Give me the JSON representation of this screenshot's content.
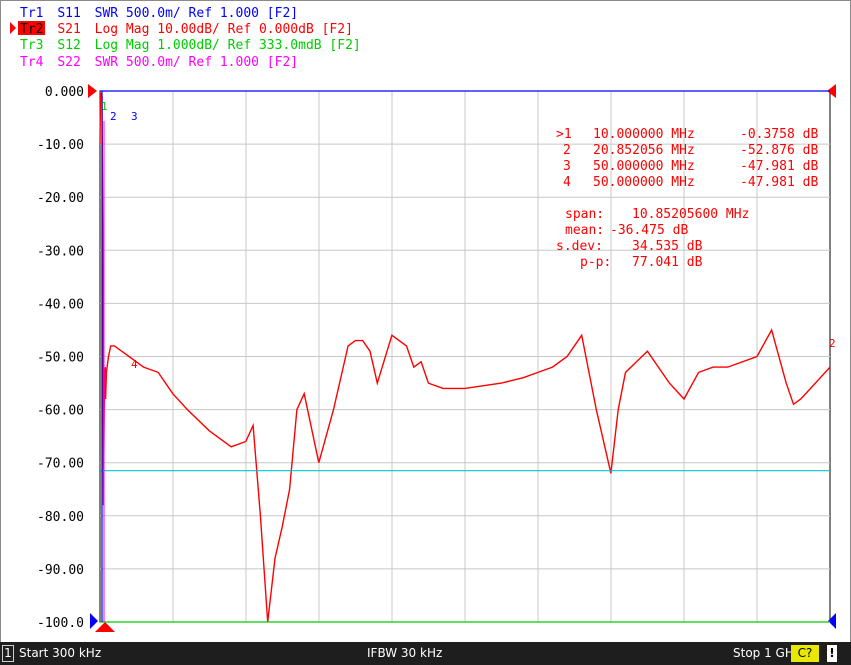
{
  "traces": [
    {
      "id": "Tr1",
      "param": "S11",
      "format": "SWR 500.0m/ Ref 1.000 [F2]",
      "color": "#0000ff",
      "active": false
    },
    {
      "id": "Tr2",
      "param": "S21",
      "format": "Log Mag 10.00dB/ Ref 0.000dB [F2]",
      "color": "#ff0000",
      "active": true
    },
    {
      "id": "Tr3",
      "param": "S12",
      "format": "Log Mag 1.000dB/ Ref 333.0mdB [F2]",
      "color": "#00cc00",
      "active": false
    },
    {
      "id": "Tr4",
      "param": "S22",
      "format": "SWR 500.0m/ Ref 1.000 [F2]",
      "color": "#ff00ff",
      "active": false
    }
  ],
  "markers": [
    {
      "label": ">1",
      "freq": "10.000000 MHz",
      "value": "-0.3758 dB"
    },
    {
      "label": "2",
      "freq": "20.852056 MHz",
      "value": "-52.876 dB"
    },
    {
      "label": "3",
      "freq": "50.000000 MHz",
      "value": "-47.981 dB"
    },
    {
      "label": "4",
      "freq": "50.000000 MHz",
      "value": "-47.981 dB"
    }
  ],
  "stats": {
    "span_label": "span:",
    "span": "10.85205600 MHz",
    "mean_label": "mean:",
    "mean": "-36.475 dB",
    "sdev_label": "s.dev:",
    "sdev": "34.535 dB",
    "pp_label": "p-p:",
    "pp": "77.041 dB"
  },
  "status": {
    "channel": "1",
    "start": "Start 300 kHz",
    "ifbw": "IFBW 30 kHz",
    "stop": "Stop 1 GHz",
    "cal": "C?",
    "warn": "!"
  },
  "colors": {
    "s21": "#ff0000",
    "s11": "#0000ff",
    "s12": "#00cc00",
    "s22": "#ff00ff",
    "limit": "#00c8c8",
    "grid": "#c8c8c8"
  },
  "chart_data": {
    "type": "line",
    "yticks": [
      "0.000",
      "-10.00",
      "-20.00",
      "-30.00",
      "-40.00",
      "-50.00",
      "-60.00",
      "-70.00",
      "-80.00",
      "-90.00",
      "-100.0"
    ],
    "ylim": [
      -100,
      0
    ],
    "xlim_mhz": [
      0.3,
      1000
    ],
    "grid": true,
    "series": [
      {
        "name": "S21",
        "x_mhz": [
          0.3,
          1,
          2,
          3,
          4,
          5,
          6,
          7,
          7.5,
          8,
          9,
          10,
          12,
          15,
          20,
          30,
          40,
          50,
          60,
          80,
          100,
          120,
          150,
          180,
          200,
          210,
          220,
          230,
          240,
          250,
          260,
          270,
          280,
          300,
          320,
          340,
          350,
          360,
          370,
          380,
          400,
          420,
          430,
          440,
          450,
          470,
          500,
          550,
          580,
          600,
          620,
          640,
          660,
          680,
          700,
          710,
          720,
          750,
          780,
          800,
          820,
          840,
          860,
          900,
          920,
          940,
          950,
          960,
          980,
          1000
        ],
        "y_db": [
          -10,
          -0.4,
          -0.5,
          -1,
          -25,
          -78,
          -60,
          -55,
          -52,
          -58,
          -53,
          -52,
          -50,
          -48,
          -48,
          -49,
          -50,
          -51,
          -52,
          -53,
          -57,
          -60,
          -64,
          -67,
          -66,
          -63,
          -80,
          -100,
          -88,
          -82,
          -75,
          -60,
          -57,
          -70,
          -60,
          -48,
          -47,
          -47,
          -49,
          -55,
          -46,
          -48,
          -52,
          -51,
          -55,
          -56,
          -56,
          -55,
          -54,
          -53,
          -52,
          -50,
          -46,
          -60,
          -72,
          -60,
          -53,
          -49,
          -55,
          -58,
          -53,
          -52,
          -52,
          -50,
          -45,
          -55,
          -59,
          -58,
          -55,
          -52
        ]
      },
      {
        "name": "S12",
        "x_mhz": [
          0.3,
          1000
        ],
        "y_db": [
          -100,
          -100
        ]
      },
      {
        "name": "S11",
        "x_mhz": [
          0.3,
          1000
        ],
        "y_db": [
          0,
          0
        ]
      },
      {
        "name": "limit",
        "x_mhz": [
          0.3,
          1000
        ],
        "y_db": [
          -71.5,
          -71.5
        ]
      }
    ]
  }
}
